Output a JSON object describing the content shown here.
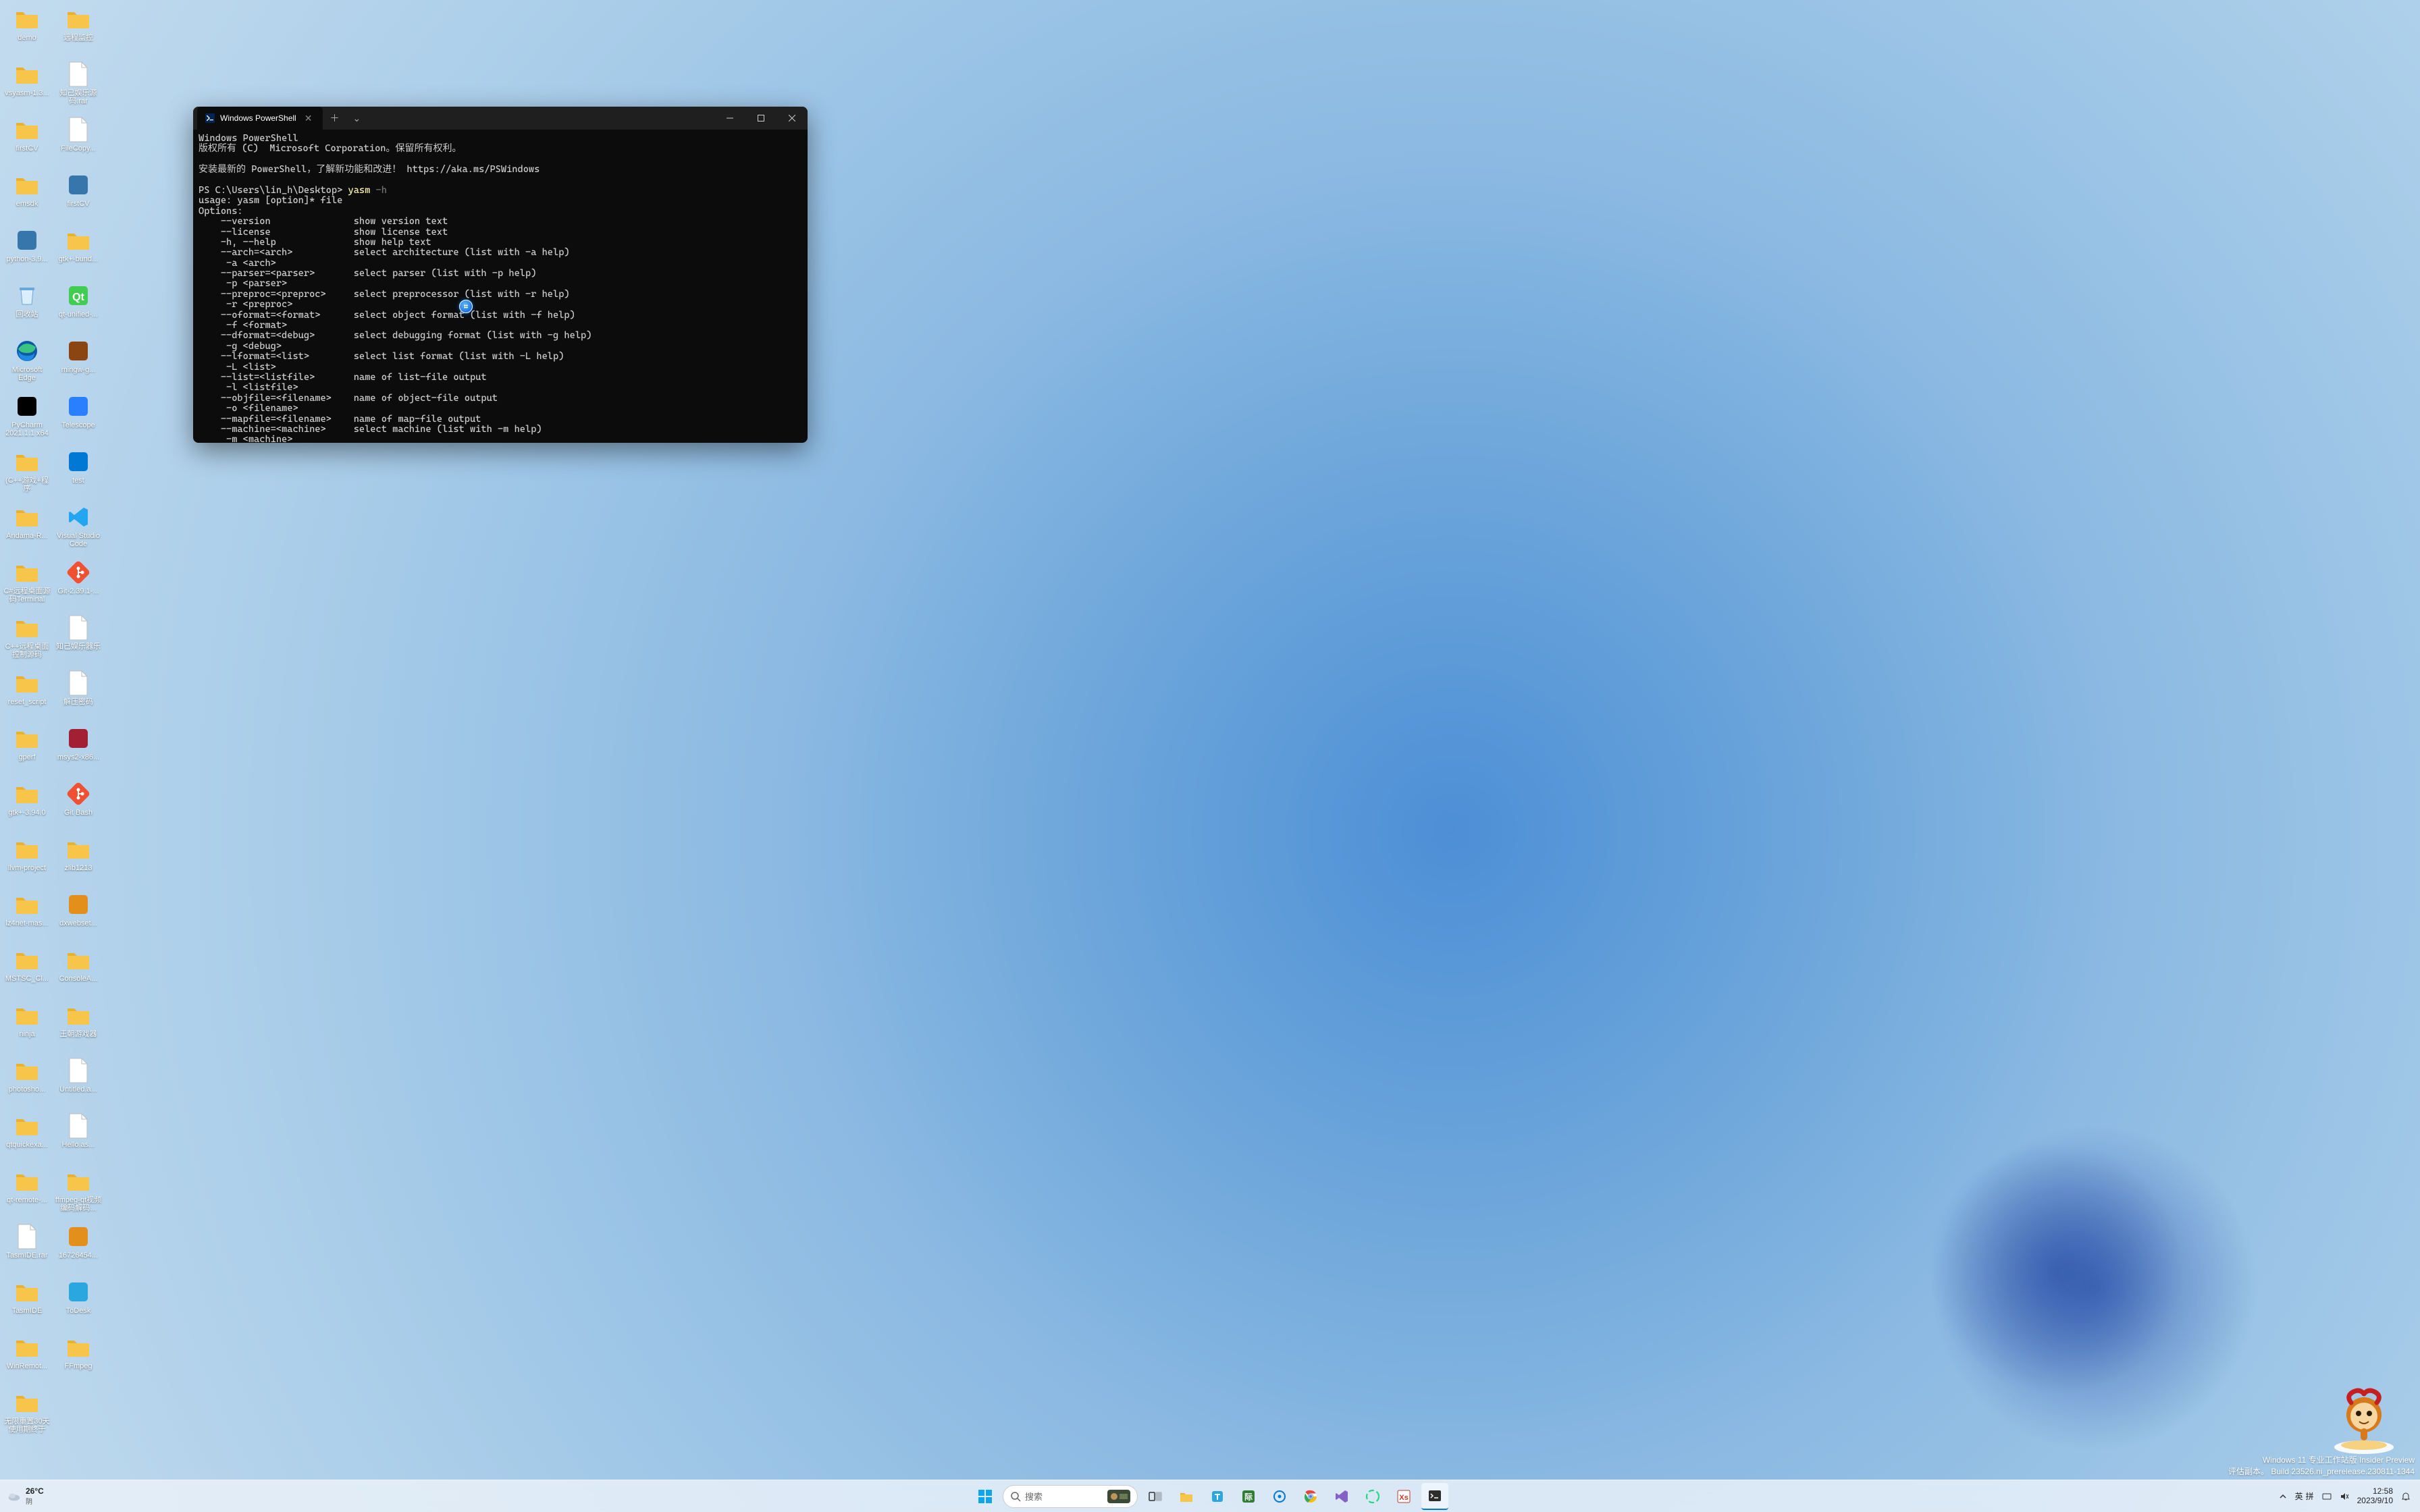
{
  "desktop_icons": [
    {
      "label": "demo",
      "type": "folder"
    },
    {
      "label": "vsyasm-1.3...",
      "type": "folder"
    },
    {
      "label": "firstCV",
      "type": "folder"
    },
    {
      "label": "emsdk",
      "type": "folder"
    },
    {
      "label": "python-3.9...",
      "type": "app",
      "color": "#3776ab"
    },
    {
      "label": "回收站",
      "type": "recycle"
    },
    {
      "label": "Microsoft Edge",
      "type": "edge"
    },
    {
      "label": "PyCharm 2021.1.1 x64",
      "type": "app",
      "color": "#000"
    },
    {
      "label": "(C++游戏+程序",
      "type": "folder"
    },
    {
      "label": "Andama-R...",
      "type": "folder"
    },
    {
      "label": "C#远程桌面源码Terminal",
      "type": "folder"
    },
    {
      "label": "C++远程桌面控制源码",
      "type": "folder"
    },
    {
      "label": "reset_script",
      "type": "folder"
    },
    {
      "label": "gperf",
      "type": "folder"
    },
    {
      "label": "gtk+-3.94.0",
      "type": "folder"
    },
    {
      "label": "llvm-project",
      "type": "folder"
    },
    {
      "label": "lz4net-mas...",
      "type": "folder"
    },
    {
      "label": "MSTSC_Cl...",
      "type": "folder"
    },
    {
      "label": "ninja",
      "type": "folder"
    },
    {
      "label": "photosho...",
      "type": "folder"
    },
    {
      "label": "qtquickexa...",
      "type": "folder"
    },
    {
      "label": "qt-remote-...",
      "type": "folder"
    },
    {
      "label": "TasmIDE.rar",
      "type": "file"
    },
    {
      "label": "TasmIDE",
      "type": "folder"
    },
    {
      "label": "WinRemot...",
      "type": "folder"
    },
    {
      "label": "无限重置30天使用期终于",
      "type": "folder"
    },
    {
      "label": "远程监控",
      "type": "folder"
    },
    {
      "label": "知己娱乐源码.rar",
      "type": "file"
    },
    {
      "label": "FileCopy...",
      "type": "file"
    },
    {
      "label": "firstCV",
      "type": "app",
      "color": "#3776ab"
    },
    {
      "label": "gtk+-bund...",
      "type": "folder"
    },
    {
      "label": "qt-unified-...",
      "type": "qt"
    },
    {
      "label": "mingw-g...",
      "type": "app",
      "color": "#8b4513"
    },
    {
      "label": "Telescope",
      "type": "app",
      "color": "#2a7fff"
    },
    {
      "label": "test",
      "type": "app",
      "color": "#0078d4"
    },
    {
      "label": "Visual Studio Code",
      "type": "vscode"
    },
    {
      "label": "Git-2.39.1-...",
      "type": "git"
    },
    {
      "label": "知己娱乐器乐",
      "type": "file"
    },
    {
      "label": "解压密码",
      "type": "file"
    },
    {
      "label": "msys2-x86...",
      "type": "app",
      "color": "#a31f34"
    },
    {
      "label": "Git Bash",
      "type": "git"
    },
    {
      "label": "zlib1213",
      "type": "folder"
    },
    {
      "label": "dxwebset...",
      "type": "app",
      "color": "#e38f1c"
    },
    {
      "label": "ConsoleA...",
      "type": "folder"
    },
    {
      "label": "王朝游戏器",
      "type": "folder"
    },
    {
      "label": "Untitled.a...",
      "type": "file"
    },
    {
      "label": "Hello.as...",
      "type": "file"
    },
    {
      "label": "ffmpeg-qt视频编码解码...",
      "type": "folder"
    },
    {
      "label": "16726454...",
      "type": "app",
      "color": "#e38f1c"
    },
    {
      "label": "ToDesk",
      "type": "app",
      "color": "#2aa7df"
    },
    {
      "label": "FFmpeg",
      "type": "folder"
    }
  ],
  "terminal": {
    "tab_title": "Windows PowerShell",
    "lines_pre": "Windows PowerShell\n版权所有 (C)  Microsoft Corporation。保留所有权利。\n\n安装最新的 PowerShell，了解新功能和改进！ https://aka.ms/PSWindows\n\n",
    "prompt": "PS C:\\Users\\lin_h\\Desktop> ",
    "cmd": "yasm",
    "cmd_suffix": " -h",
    "output": "usage: yasm [option]* file\nOptions:\n    --version               show version text\n    --license               show license text\n    -h, --help              show help text\n    --arch=<arch>           select architecture (list with -a help)\n     -a <arch>\n    --parser=<parser>       select parser (list with -p help)\n     -p <parser>\n    --preproc=<preproc>     select preprocessor (list with -r help)\n     -r <preproc>\n    --oformat=<format>      select object format (list with -f help)\n     -f <format>\n    --dformat=<debug>       select debugging format (list with -g help)\n     -g <debug>\n    --lformat=<list>        select list format (list with -L help)\n     -L <list>\n    --list=<listfile>       name of list-file output\n     -l <listfile>\n    --objfile=<filename>    name of object-file output\n     -o <filename>\n    --mapfile=<filename>    name of map-file output\n    --machine=<machine>     select machine (list with -m help)\n     -m <machine>"
  },
  "watermark": {
    "line1": "Windows 11 专业工作站版 Insider Preview",
    "line2": "评估副本。 Build 23526.ni_prerelease.230811-1344"
  },
  "taskbar": {
    "weather_temp": "26°C",
    "weather_desc": "阴",
    "search_placeholder": "搜索",
    "ime1": "英",
    "ime2": "拼",
    "time": "12:58",
    "date": "2023/9/10"
  }
}
